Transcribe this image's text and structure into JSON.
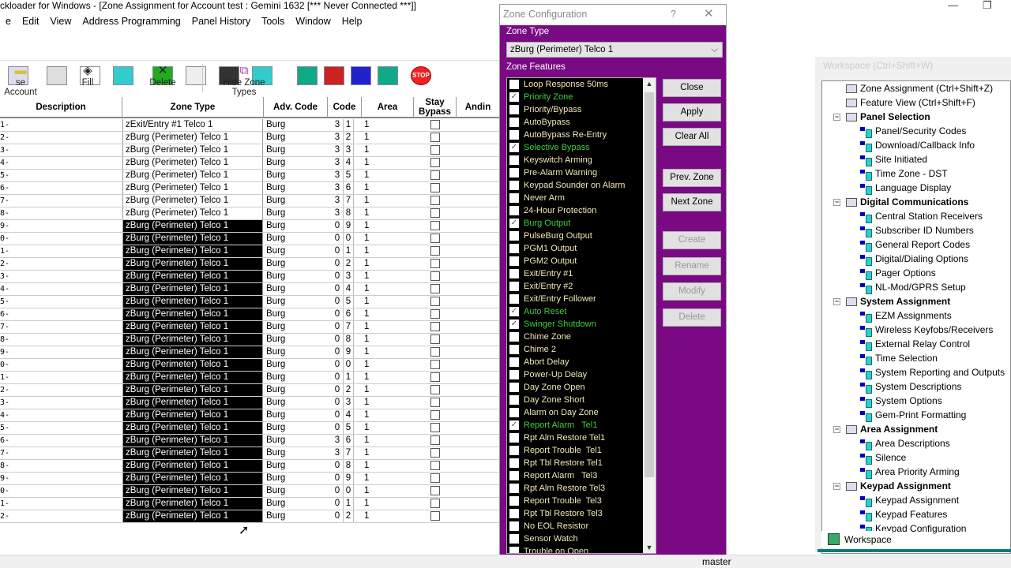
{
  "window": {
    "title": "ckloader for Windows - [Zone Assignment for Account test : Gemini 1632 [*** Never Connected ***]]",
    "minimize": "—",
    "restore": "❐"
  },
  "menu": [
    "e",
    "Edit",
    "View",
    "Address Programming",
    "Panel History",
    "Tools",
    "Window",
    "Help"
  ],
  "toolbar_icons": [
    "panel-icon",
    "keypad-icon",
    "pole-icon",
    "system-icon",
    "areas-icon",
    "keyboard-icon",
    "users-icon",
    "schedule-icon",
    "phone-l-icon",
    "phone-r-icon",
    "phone-t-icon",
    "download-icon",
    "stop-icon"
  ],
  "stop_label": "STOP",
  "toolbar": {
    "close_account": "se Account",
    "fill": "Fill",
    "delete": "Delete",
    "hide_zone_types": "Hide Zone Types"
  },
  "grid": {
    "headers": {
      "description": "Description",
      "zone_type": "Zone Type",
      "adv_code": "Adv. Code",
      "code": "Code",
      "area": "Area",
      "stay_bypass": "Stay Bypass",
      "anding": "Andin"
    },
    "rows": [
      {
        "d": "1-",
        "zt": "zExit/Entry #1 Telco 1",
        "adv": "Burg",
        "c1": "3",
        "c2": "1",
        "area": "1",
        "sel": false
      },
      {
        "d": "2-",
        "zt": "zBurg (Perimeter) Telco 1",
        "adv": "Burg",
        "c1": "3",
        "c2": "2",
        "area": "1",
        "sel": false
      },
      {
        "d": "3-",
        "zt": "zBurg (Perimeter) Telco 1",
        "adv": "Burg",
        "c1": "3",
        "c2": "3",
        "area": "1",
        "sel": false
      },
      {
        "d": "4-",
        "zt": "zBurg (Perimeter) Telco 1",
        "adv": "Burg",
        "c1": "3",
        "c2": "4",
        "area": "1",
        "sel": false
      },
      {
        "d": "5-",
        "zt": "zBurg (Perimeter) Telco 1",
        "adv": "Burg",
        "c1": "3",
        "c2": "5",
        "area": "1",
        "sel": false
      },
      {
        "d": "6-",
        "zt": "zBurg (Perimeter) Telco 1",
        "adv": "Burg",
        "c1": "3",
        "c2": "6",
        "area": "1",
        "sel": false
      },
      {
        "d": "7-",
        "zt": "zBurg (Perimeter) Telco 1",
        "adv": "Burg",
        "c1": "3",
        "c2": "7",
        "area": "1",
        "sel": false
      },
      {
        "d": "8-",
        "zt": "zBurg (Perimeter) Telco 1",
        "adv": "Burg",
        "c1": "3",
        "c2": "8",
        "area": "1",
        "sel": false
      },
      {
        "d": "9-",
        "zt": "zBurg (Perimeter) Telco 1",
        "adv": "Burg",
        "c1": "0",
        "c2": "9",
        "area": "1",
        "sel": true
      },
      {
        "d": "0-",
        "zt": "zBurg (Perimeter) Telco 1",
        "adv": "Burg",
        "c1": "0",
        "c2": "0",
        "area": "1",
        "sel": true
      },
      {
        "d": "1-",
        "zt": "zBurg (Perimeter) Telco 1",
        "adv": "Burg",
        "c1": "0",
        "c2": "1",
        "area": "1",
        "sel": true
      },
      {
        "d": "2-",
        "zt": "zBurg (Perimeter) Telco 1",
        "adv": "Burg",
        "c1": "0",
        "c2": "2",
        "area": "1",
        "sel": true
      },
      {
        "d": "3-",
        "zt": "zBurg (Perimeter) Telco 1",
        "adv": "Burg",
        "c1": "0",
        "c2": "3",
        "area": "1",
        "sel": true
      },
      {
        "d": "4-",
        "zt": "zBurg (Perimeter) Telco 1",
        "adv": "Burg",
        "c1": "0",
        "c2": "4",
        "area": "1",
        "sel": true
      },
      {
        "d": "5-",
        "zt": "zBurg (Perimeter) Telco 1",
        "adv": "Burg",
        "c1": "0",
        "c2": "5",
        "area": "1",
        "sel": true
      },
      {
        "d": "6-",
        "zt": "zBurg (Perimeter) Telco 1",
        "adv": "Burg",
        "c1": "0",
        "c2": "6",
        "area": "1",
        "sel": true
      },
      {
        "d": "7-",
        "zt": "zBurg (Perimeter) Telco 1",
        "adv": "Burg",
        "c1": "0",
        "c2": "7",
        "area": "1",
        "sel": true
      },
      {
        "d": "8-",
        "zt": "zBurg (Perimeter) Telco 1",
        "adv": "Burg",
        "c1": "0",
        "c2": "8",
        "area": "1",
        "sel": true
      },
      {
        "d": "9-",
        "zt": "zBurg (Perimeter) Telco 1",
        "adv": "Burg",
        "c1": "0",
        "c2": "9",
        "area": "1",
        "sel": true
      },
      {
        "d": "0-",
        "zt": "zBurg (Perimeter) Telco 1",
        "adv": "Burg",
        "c1": "0",
        "c2": "0",
        "area": "1",
        "sel": true
      },
      {
        "d": "1-",
        "zt": "zBurg (Perimeter) Telco 1",
        "adv": "Burg",
        "c1": "0",
        "c2": "1",
        "area": "1",
        "sel": true
      },
      {
        "d": "2-",
        "zt": "zBurg (Perimeter) Telco 1",
        "adv": "Burg",
        "c1": "0",
        "c2": "2",
        "area": "1",
        "sel": true
      },
      {
        "d": "3-",
        "zt": "zBurg (Perimeter) Telco 1",
        "adv": "Burg",
        "c1": "0",
        "c2": "3",
        "area": "1",
        "sel": true
      },
      {
        "d": "4-",
        "zt": "zBurg (Perimeter) Telco 1",
        "adv": "Burg",
        "c1": "0",
        "c2": "4",
        "area": "1",
        "sel": true
      },
      {
        "d": "5-",
        "zt": "zBurg (Perimeter) Telco 1",
        "adv": "Burg",
        "c1": "0",
        "c2": "5",
        "area": "1",
        "sel": true
      },
      {
        "d": "6-",
        "zt": "zBurg (Perimeter) Telco 1",
        "adv": "Burg",
        "c1": "3",
        "c2": "6",
        "area": "1",
        "sel": true
      },
      {
        "d": "7-",
        "zt": "zBurg (Perimeter) Telco 1",
        "adv": "Burg",
        "c1": "3",
        "c2": "7",
        "area": "1",
        "sel": true
      },
      {
        "d": "8-",
        "zt": "zBurg (Perimeter) Telco 1",
        "adv": "Burg",
        "c1": "0",
        "c2": "8",
        "area": "1",
        "sel": true
      },
      {
        "d": "9-",
        "zt": "zBurg (Perimeter) Telco 1",
        "adv": "Burg",
        "c1": "0",
        "c2": "9",
        "area": "1",
        "sel": true
      },
      {
        "d": "0-",
        "zt": "zBurg (Perimeter) Telco 1",
        "adv": "Burg",
        "c1": "0",
        "c2": "0",
        "area": "1",
        "sel": true
      },
      {
        "d": "1-",
        "zt": "zBurg (Perimeter) Telco 1",
        "adv": "Burg",
        "c1": "0",
        "c2": "1",
        "area": "1",
        "sel": true
      },
      {
        "d": "2-",
        "zt": "zBurg (Perimeter) Telco 1",
        "adv": "Burg",
        "c1": "0",
        "c2": "2",
        "area": "1",
        "sel": true
      }
    ]
  },
  "dialog": {
    "title": "Zone Configuration",
    "help": "?",
    "close": "✕",
    "zone_type_label": "Zone Type",
    "zone_type_value": "zBurg (Perimeter) Telco 1",
    "features_label": "Zone Features",
    "features": [
      {
        "label": "Loop Response 50ms",
        "checked": false
      },
      {
        "label": "Priority Zone",
        "checked": true
      },
      {
        "label": "Priority/Bypass",
        "checked": false
      },
      {
        "label": "AutoBypass",
        "checked": false
      },
      {
        "label": "AutoBypass Re-Entry",
        "checked": false
      },
      {
        "label": "Selective Bypass",
        "checked": true
      },
      {
        "label": "Keyswitch Arming",
        "checked": false
      },
      {
        "label": "Pre-Alarm Warning",
        "checked": false
      },
      {
        "label": "Keypad Sounder on Alarm",
        "checked": false
      },
      {
        "label": "Never Arm",
        "checked": false
      },
      {
        "label": "24-Hour Protection",
        "checked": false
      },
      {
        "label": "Burg Output",
        "checked": true
      },
      {
        "label": "PulseBurg Output",
        "checked": false
      },
      {
        "label": "PGM1 Output",
        "checked": false
      },
      {
        "label": "PGM2 Output",
        "checked": false
      },
      {
        "label": "Exit/Entry #1",
        "checked": false
      },
      {
        "label": "Exit/Entry #2",
        "checked": false
      },
      {
        "label": "Exit/Entry Follower",
        "checked": false
      },
      {
        "label": "Auto Reset",
        "checked": true
      },
      {
        "label": "Swinger Shutdown",
        "checked": true
      },
      {
        "label": "Chime Zone",
        "checked": false
      },
      {
        "label": "Chime 2",
        "checked": false
      },
      {
        "label": "Abort Delay",
        "checked": false
      },
      {
        "label": "Power-Up Delay",
        "checked": false
      },
      {
        "label": "Day Zone Open",
        "checked": false
      },
      {
        "label": "Day Zone Short",
        "checked": false
      },
      {
        "label": "Alarm on Day Zone",
        "checked": false
      },
      {
        "label": "Report Alarm   Tel1",
        "checked": true
      },
      {
        "label": "Rpt Alm Restore Tel1",
        "checked": false
      },
      {
        "label": "Report Trouble  Tel1",
        "checked": false
      },
      {
        "label": "Rpt Tbl Restore Tel1",
        "checked": false
      },
      {
        "label": "Report Alarm   Tel3",
        "checked": false
      },
      {
        "label": "Rpt Alm Restore Tel3",
        "checked": false
      },
      {
        "label": "Report Trouble  Tel3",
        "checked": false
      },
      {
        "label": "Rpt Tbl Restore Tel3",
        "checked": false
      },
      {
        "label": "No EOL Resistor",
        "checked": false
      },
      {
        "label": "Sensor Watch",
        "checked": false
      },
      {
        "label": "Trouble on Open",
        "checked": false
      }
    ],
    "buttons": [
      {
        "label": "Close",
        "enabled": true
      },
      {
        "label": "Apply",
        "enabled": true
      },
      {
        "label": "Clear All",
        "enabled": true
      },
      {
        "label": "Prev. Zone",
        "enabled": true
      },
      {
        "label": "Next Zone",
        "enabled": true
      },
      {
        "label": "Create",
        "enabled": false
      },
      {
        "label": "Rename",
        "enabled": false
      },
      {
        "label": "Modify",
        "enabled": false
      },
      {
        "label": "Delete",
        "enabled": false
      }
    ],
    "colors": {
      "background": "#7a0a84",
      "checked_text": "#3dd03d",
      "unchecked_text": "#f0e8b8"
    }
  },
  "workspace": {
    "title": "Workspace (Ctrl+Shift+W)",
    "partial_label": "Delete",
    "tab": "Workspace",
    "tree": [
      {
        "label": "Zone Assignment (Ctrl+Shift+Z)",
        "kind": "top"
      },
      {
        "label": "Feature View (Ctrl+Shift+F)",
        "kind": "top"
      },
      {
        "label": "Panel Selection",
        "kind": "grp"
      },
      {
        "label": "Panel/Security Codes",
        "kind": "leaf"
      },
      {
        "label": "Download/Callback Info",
        "kind": "leaf"
      },
      {
        "label": "Site Initiated",
        "kind": "leaf"
      },
      {
        "label": "Time Zone - DST",
        "kind": "leaf"
      },
      {
        "label": "Language Display",
        "kind": "leaf"
      },
      {
        "label": "Digital Communications",
        "kind": "grp"
      },
      {
        "label": "Central Station Receivers",
        "kind": "leaf"
      },
      {
        "label": "Subscriber ID Numbers",
        "kind": "leaf"
      },
      {
        "label": "General Report Codes",
        "kind": "leaf"
      },
      {
        "label": "Digital/Dialing Options",
        "kind": "leaf"
      },
      {
        "label": "Pager Options",
        "kind": "leaf"
      },
      {
        "label": "NL-Mod/GPRS Setup",
        "kind": "leaf"
      },
      {
        "label": "System Assignment",
        "kind": "grp"
      },
      {
        "label": "EZM Assignments",
        "kind": "leaf"
      },
      {
        "label": "Wireless Keyfobs/Receivers",
        "kind": "leaf"
      },
      {
        "label": "External Relay Control",
        "kind": "leaf"
      },
      {
        "label": "Time Selection",
        "kind": "leaf"
      },
      {
        "label": "System Reporting and Outputs",
        "kind": "leaf"
      },
      {
        "label": "System Descriptions",
        "kind": "leaf"
      },
      {
        "label": "System Options",
        "kind": "leaf"
      },
      {
        "label": "Gem-Print Formatting",
        "kind": "leaf"
      },
      {
        "label": "Area Assignment",
        "kind": "grp"
      },
      {
        "label": "Area Descriptions",
        "kind": "leaf"
      },
      {
        "label": "Silence",
        "kind": "leaf"
      },
      {
        "label": "Area Priority Arming",
        "kind": "leaf"
      },
      {
        "label": "Keypad Assignment",
        "kind": "grp"
      },
      {
        "label": "Keypad Assignment",
        "kind": "leaf"
      },
      {
        "label": "Keypad Features",
        "kind": "leaf"
      },
      {
        "label": "Keypad Configuration",
        "kind": "leaf"
      }
    ]
  },
  "status": {
    "branch": "master"
  }
}
